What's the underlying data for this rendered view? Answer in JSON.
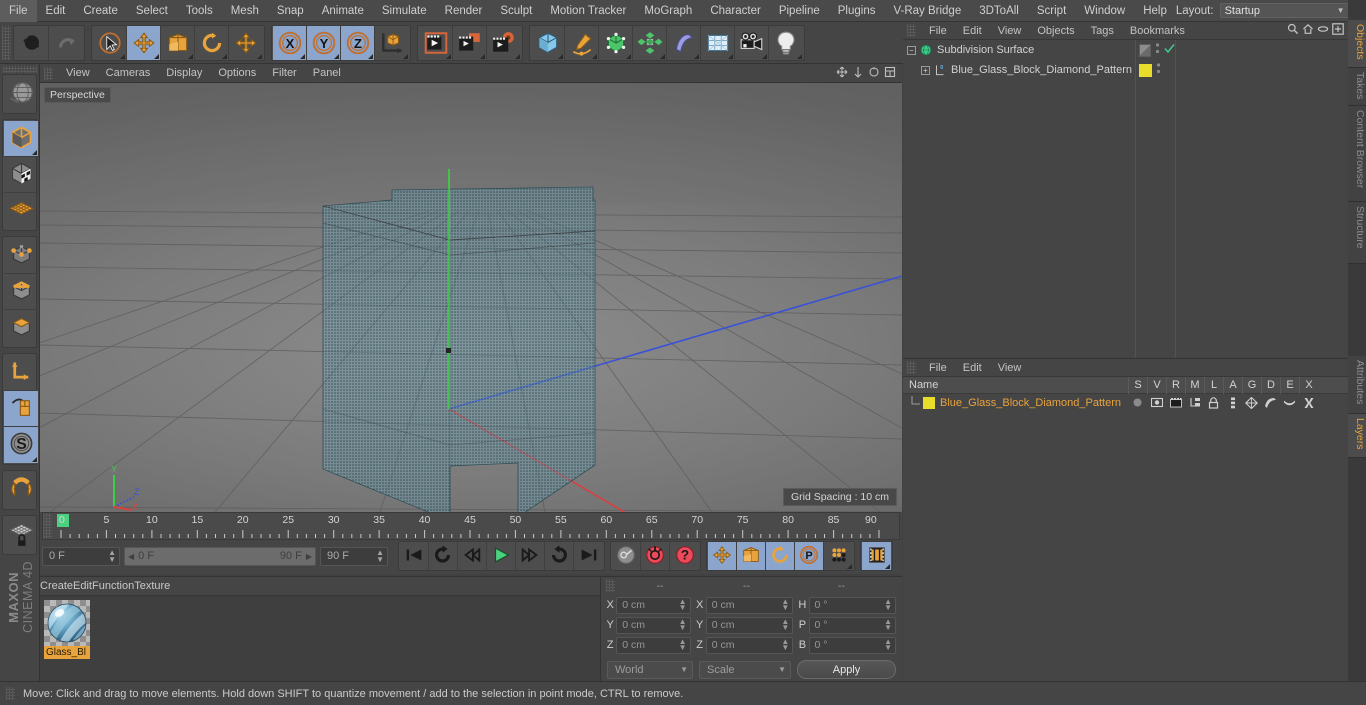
{
  "menubar": {
    "items": [
      "File",
      "Edit",
      "Create",
      "Select",
      "Tools",
      "Mesh",
      "Snap",
      "Animate",
      "Simulate",
      "Render",
      "Sculpt",
      "Motion Tracker",
      "MoGraph",
      "Character",
      "Pipeline",
      "Plugins",
      "V-Ray Bridge",
      "3DToAll",
      "Script",
      "Window",
      "Help"
    ],
    "layout_label": "Layout:",
    "layout_value": "Startup",
    "search_icon": "search-icon"
  },
  "toolbar": {
    "groups": [
      {
        "name": "history",
        "buttons": [
          {
            "name": "undo",
            "icon": "undo-arrow-icon",
            "active": false
          },
          {
            "name": "redo",
            "icon": "redo-arrow-icon",
            "active": false
          }
        ]
      },
      {
        "name": "tools",
        "buttons": [
          {
            "name": "live-selection",
            "icon": "selection-arrow-icon",
            "active": false
          },
          {
            "name": "move",
            "icon": "move-arrows-icon",
            "active": true
          },
          {
            "name": "scale",
            "icon": "scale-box-icon",
            "active": false
          },
          {
            "name": "rotate",
            "icon": "rotate-circle-icon",
            "active": false
          },
          {
            "name": "move-dup",
            "icon": "move-arrows-icon",
            "active": false
          }
        ]
      },
      {
        "name": "axis-locks",
        "buttons": [
          {
            "name": "lock-x",
            "icon": "x-axis-icon",
            "active": true
          },
          {
            "name": "lock-y",
            "icon": "y-axis-icon",
            "active": true
          },
          {
            "name": "lock-z",
            "icon": "z-axis-icon",
            "active": true
          },
          {
            "name": "world-object-axis",
            "icon": "world-axis-cube-icon",
            "active": false
          }
        ]
      },
      {
        "name": "render",
        "buttons": [
          {
            "name": "render-view",
            "icon": "render-view-icon",
            "active": false
          },
          {
            "name": "render-region",
            "icon": "render-region-icon",
            "active": false
          },
          {
            "name": "render-settings",
            "icon": "render-settings-gear-icon",
            "active": false
          }
        ]
      },
      {
        "name": "create",
        "buttons": [
          {
            "name": "add-cube",
            "icon": "blue-cube-icon",
            "active": false
          },
          {
            "name": "add-spline",
            "icon": "pen-spline-icon",
            "active": false
          },
          {
            "name": "add-nurbs",
            "icon": "green-generator-cube-icon",
            "active": false
          },
          {
            "name": "add-array",
            "icon": "green-array-icon",
            "active": false
          },
          {
            "name": "add-deformer",
            "icon": "purple-bend-deformer-icon",
            "active": false
          },
          {
            "name": "add-environment",
            "icon": "floor-grid-icon",
            "active": false
          },
          {
            "name": "add-camera",
            "icon": "camera-icon",
            "active": false
          },
          {
            "name": "add-light",
            "icon": "light-bulb-icon",
            "active": false
          }
        ]
      }
    ]
  },
  "lefttoolbar": {
    "groups": [
      [
        {
          "name": "undo-view",
          "icon": "globe-wire-icon",
          "active": false
        }
      ],
      [
        {
          "name": "model-mode",
          "icon": "model-cube-icon",
          "active": true
        },
        {
          "name": "texture-mode",
          "icon": "texture-cube-icon",
          "active": false
        },
        {
          "name": "workplane-mode",
          "icon": "workplane-grid-icon",
          "active": false
        }
      ],
      [
        {
          "name": "points-mode",
          "icon": "points-cube-icon",
          "active": false
        },
        {
          "name": "edges-mode",
          "icon": "edges-cube-icon",
          "active": false
        },
        {
          "name": "polygons-mode",
          "icon": "polygons-cube-icon",
          "active": false
        }
      ],
      [
        {
          "name": "object-axis-mode",
          "icon": "axis-l-icon",
          "active": false
        },
        {
          "name": "enable-axis-modification",
          "icon": "mouse-axis-icon",
          "active": true
        },
        {
          "name": "viewport-solo",
          "icon": "s-compass-icon",
          "active": true
        }
      ],
      [
        {
          "name": "snap-enable",
          "icon": "magnet-icon",
          "active": false
        }
      ],
      [
        {
          "name": "workplane-lock",
          "icon": "workplane-lock-icon",
          "active": false
        }
      ]
    ],
    "brand_bold": "MAXON",
    "brand_thin": "CINEMA 4D"
  },
  "viewport": {
    "menu_items": [
      "View",
      "Cameras",
      "Display",
      "Options",
      "Filter",
      "Panel"
    ],
    "camera_label": "Perspective",
    "grid_spacing_label": "Grid Spacing : 10 cm",
    "axis_gizmo": {
      "y": "Y",
      "z": "Z",
      "x": "X"
    },
    "object_color": "#6ea4b4",
    "colors": {
      "x_axis": "#d94040",
      "y_axis": "#3fcc49",
      "z_axis": "#3b52d6"
    }
  },
  "timeline": {
    "ticks": [
      0,
      5,
      10,
      15,
      20,
      25,
      30,
      35,
      40,
      45,
      50,
      55,
      60,
      65,
      70,
      75,
      80,
      85,
      90
    ],
    "current_frame_field": "0 F",
    "range_start": "0 F",
    "range_end": "90 F",
    "max_frame_field": "90 F",
    "end_frame_field": "0 F",
    "playhead_frame": 0,
    "buttons": [
      {
        "name": "go-to-start",
        "icon": "skip-start-icon",
        "active": false
      },
      {
        "name": "play-reverse",
        "icon": "loop-back-icon",
        "active": false
      },
      {
        "name": "step-back",
        "icon": "step-back-icon",
        "active": false
      },
      {
        "name": "play-forward",
        "icon": "play-icon",
        "active": false
      },
      {
        "name": "step-forward",
        "icon": "step-forward-icon",
        "active": false
      },
      {
        "name": "loop-playback",
        "icon": "loop-icon",
        "active": false
      },
      {
        "name": "go-to-end",
        "icon": "skip-end-icon",
        "active": false
      },
      {
        "name": "record-active-objects",
        "icon": "key-record-icon",
        "active": false
      },
      {
        "name": "autokeying",
        "icon": "autokey-red-icon",
        "active": false
      },
      {
        "name": "keyframe-selection",
        "icon": "question-red-icon",
        "active": false
      },
      {
        "name": "position-key",
        "icon": "move-arrows-icon",
        "active": true
      },
      {
        "name": "scale-key",
        "icon": "scale-box-icon",
        "active": true
      },
      {
        "name": "rotation-key",
        "icon": "rotate-circle-icon",
        "active": true
      },
      {
        "name": "param-key",
        "icon": "p-circle-icon",
        "active": true
      },
      {
        "name": "pla-key",
        "icon": "point-level-anim-icon",
        "active": false
      },
      {
        "name": "timeline-mode",
        "icon": "film-strip-icon",
        "active": true
      }
    ]
  },
  "materials": {
    "menu_items": [
      "Create",
      "Edit",
      "Function",
      "Texture"
    ],
    "items": [
      {
        "name": "Glass_Bl",
        "selected": true,
        "thumb": "blue-striped-glass-sphere"
      }
    ]
  },
  "coordinates": {
    "headers": [
      "--",
      "--",
      "--"
    ],
    "rows": [
      {
        "l1": "X",
        "v1": "0 cm",
        "l2": "X",
        "v2": "0 cm",
        "l3": "H",
        "v3": "0 °"
      },
      {
        "l1": "Y",
        "v1": "0 cm",
        "l2": "Y",
        "v2": "0 cm",
        "l3": "P",
        "v3": "0 °"
      },
      {
        "l1": "Z",
        "v1": "0 cm",
        "l2": "Z",
        "v2": "0 cm",
        "l3": "B",
        "v3": "0 °"
      }
    ],
    "space_dropdown": "World",
    "mode_dropdown": "Scale",
    "apply_label": "Apply"
  },
  "object_manager": {
    "menu_items": [
      "File",
      "Edit",
      "View",
      "Objects",
      "Tags",
      "Bookmarks"
    ],
    "header_icons": [
      "search-icon",
      "home-icon",
      "ellipse-icon",
      "plus-box-icon"
    ],
    "rows": [
      {
        "label": "Subdivision Surface",
        "icon": "subdivision-surface-icon",
        "indent": 0,
        "selected": false,
        "tag_color": null,
        "has_check": true
      },
      {
        "label": "Blue_Glass_Block_Diamond_Pattern",
        "icon": "polygon-object-icon",
        "indent": 1,
        "selected": false,
        "tag_color": "#e8dd2b",
        "has_check": false
      }
    ]
  },
  "layer_manager": {
    "menu_items": [
      "File",
      "Edit",
      "View"
    ],
    "name_column": "Name",
    "columns": [
      "S",
      "V",
      "R",
      "M",
      "L",
      "A",
      "G",
      "D",
      "E",
      "X"
    ],
    "rows": [
      {
        "label": "Blue_Glass_Block_Diamond_Pattern",
        "color": "#e8dd2b",
        "cells": [
          "solo-dot-icon",
          "view-icon",
          "render-icon",
          "manager-icon",
          "lock-icon",
          "animation-icon",
          "generator-icon",
          "deformer-icon",
          "expression-icon",
          "xref-icon"
        ]
      }
    ]
  },
  "right_tabs": {
    "top": [
      "Objects",
      "Takes",
      "Content Browser",
      "Structure"
    ],
    "bottom": [
      "Attributes",
      "Layers"
    ],
    "active_top": "Objects",
    "active_bottom": "Layers"
  },
  "statusbar": {
    "message": "Move: Click and drag to move elements. Hold down SHIFT to quantize movement / add to the selection in point mode, CTRL to remove."
  }
}
